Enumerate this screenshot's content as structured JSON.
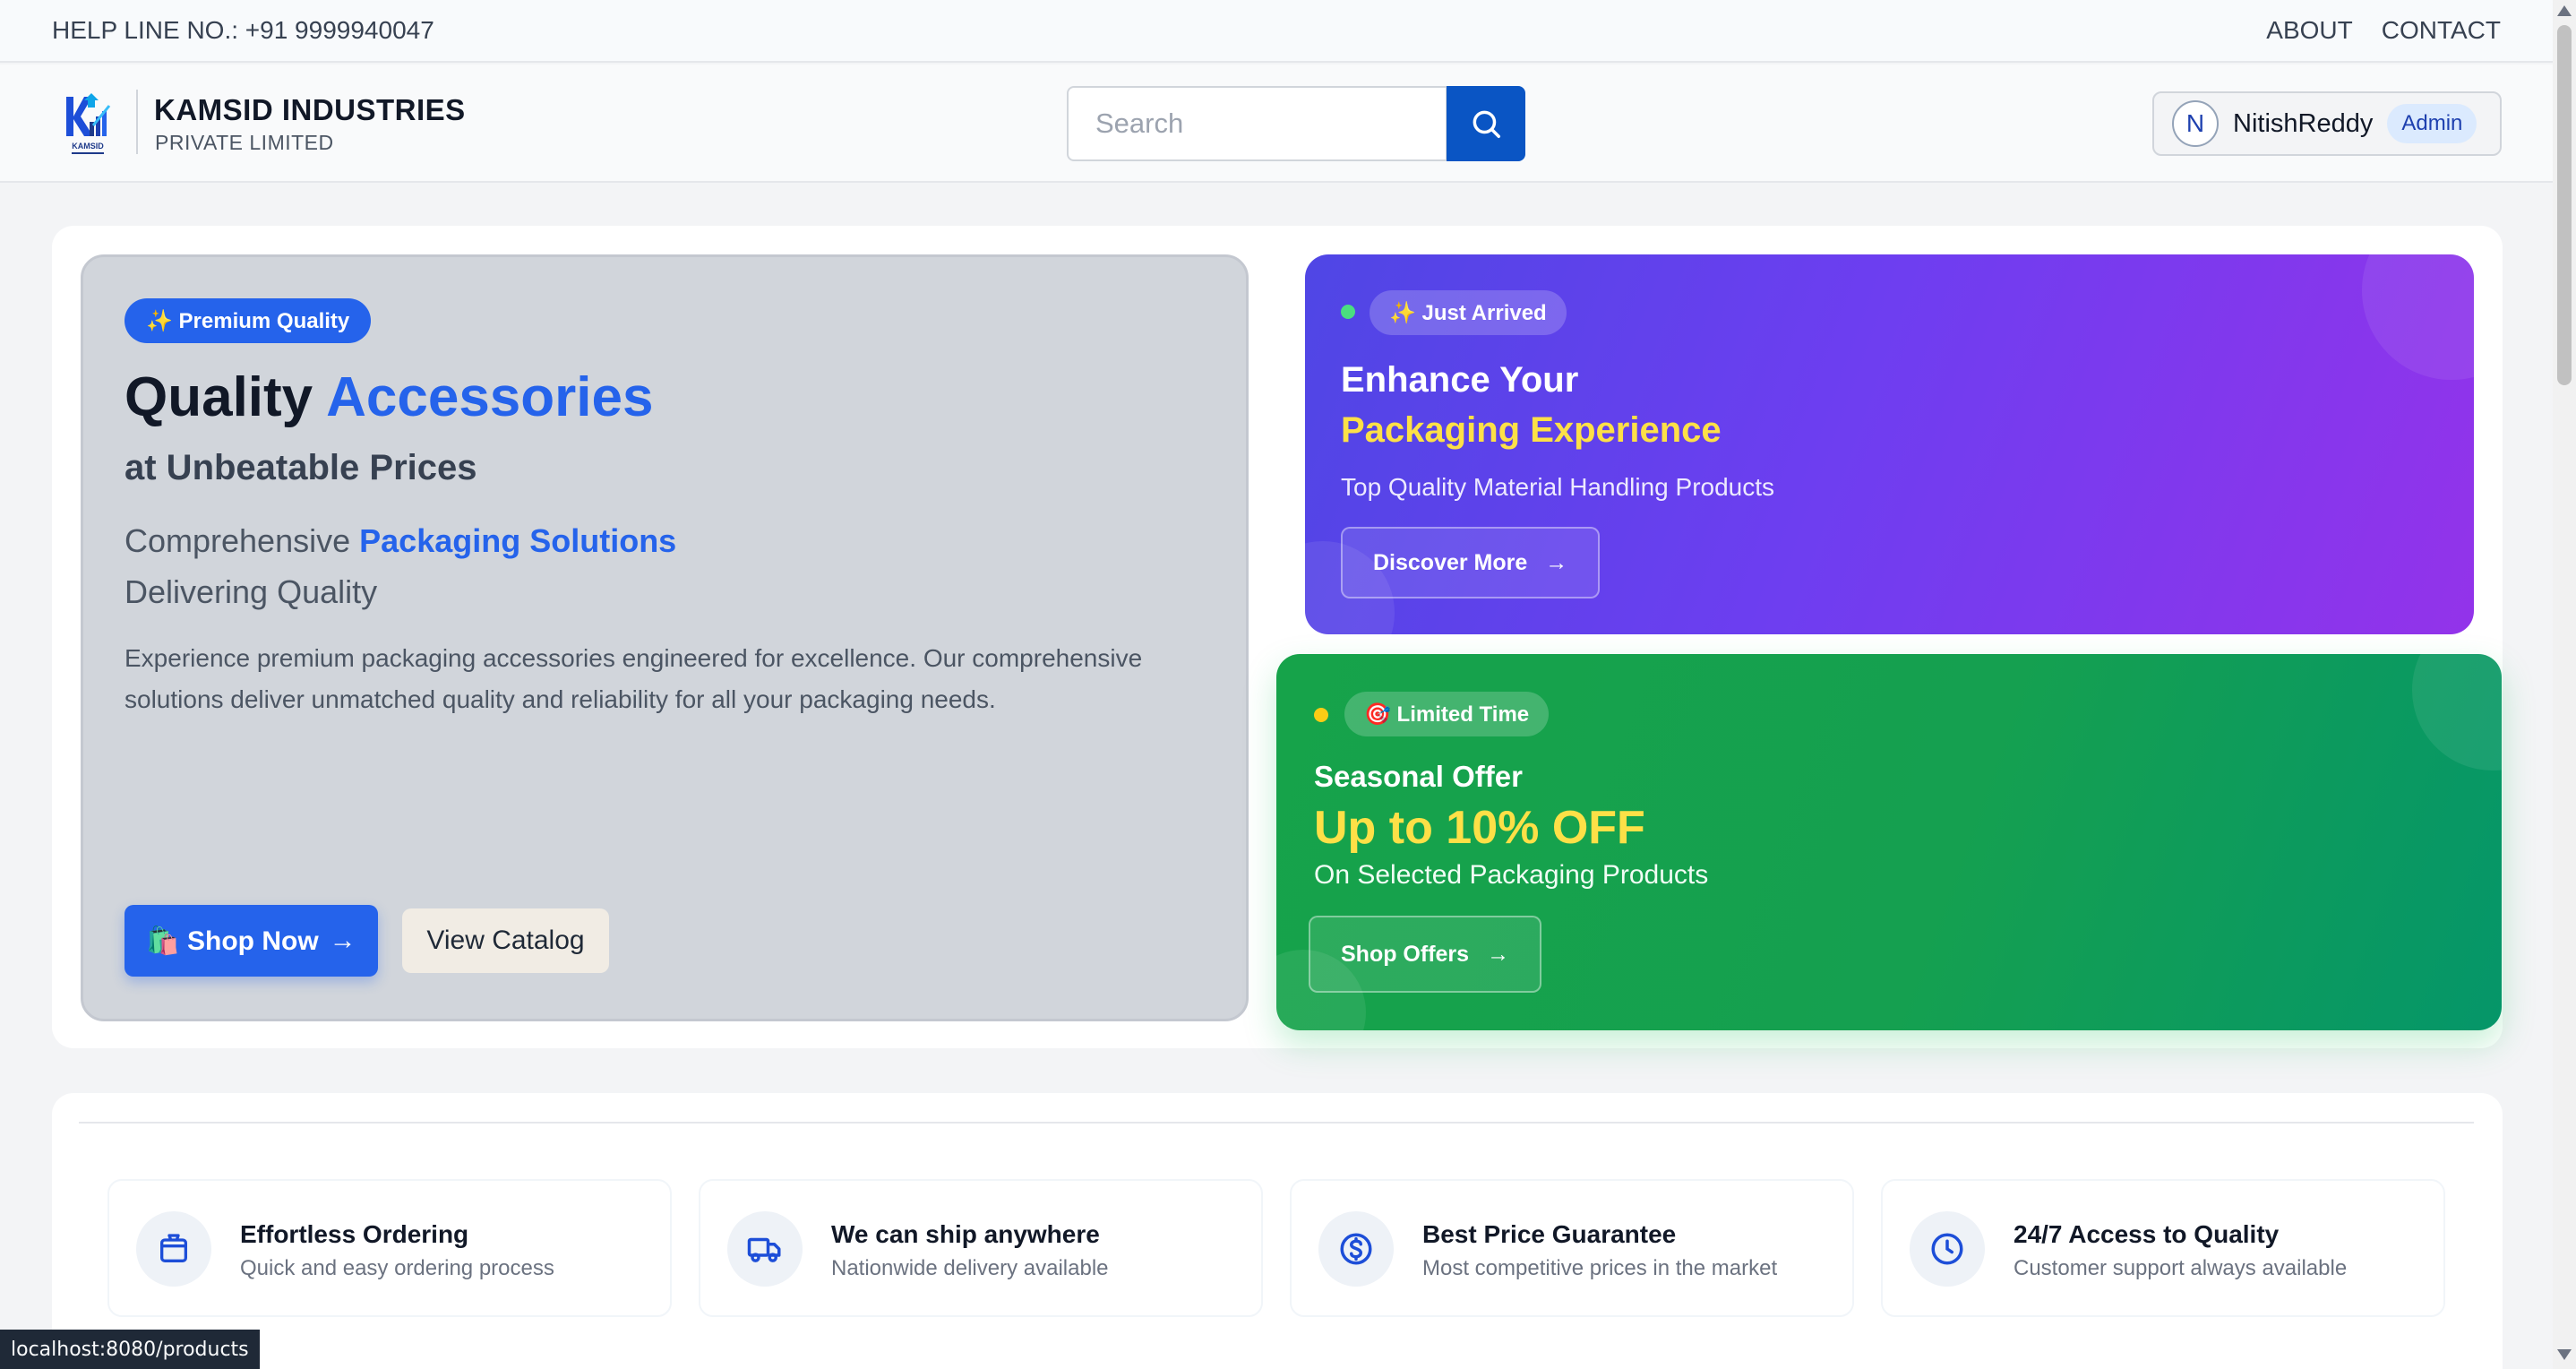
{
  "topbar": {
    "helpline": "HELP LINE NO.: +91 9999940047",
    "about": "ABOUT",
    "contact": "CONTACT"
  },
  "brand": {
    "name": "KAMSID INDUSTRIES",
    "sub": "PRIVATE LIMITED",
    "logo_text": "KAMSID"
  },
  "search": {
    "placeholder": "Search",
    "icon": "search-icon"
  },
  "user": {
    "initial": "N",
    "name": "NitishReddy",
    "role": "Admin"
  },
  "hero": {
    "badge": "✨ Premium Quality",
    "title_prefix": "Quality",
    "title_accent": "Accessories",
    "subtitle": "at Unbeatable Prices",
    "comp_prefix": "Comprehensive",
    "comp_accent": "Packaging Solutions",
    "delivering": "Delivering Quality",
    "description": "Experience premium packaging accessories engineered for excellence. Our comprehensive solutions deliver unmatched quality and reliability for all your packaging needs.",
    "shop_now": "🛍️ Shop Now",
    "shop_arrow": "→",
    "view_catalog": "View Catalog"
  },
  "promo_purple": {
    "badge": "✨ Just Arrived",
    "title_line1": "Enhance Your",
    "title_line2": "Packaging Experience",
    "subtitle": "Top Quality Material Handling Products",
    "button": "Discover More",
    "arrow": "→",
    "colors": {
      "from": "#4f46e5",
      "to": "#9333ea",
      "highlight": "#fde047"
    }
  },
  "promo_green": {
    "badge": "🎯 Limited Time",
    "title": "Seasonal Offer",
    "offer": "Up to 10% OFF",
    "subtitle": "On Selected Packaging Products",
    "button": "Shop Offers",
    "arrow": "→",
    "colors": {
      "from": "#16a34a",
      "to": "#059669",
      "highlight": "#fde047"
    }
  },
  "features": [
    {
      "icon": "package-icon",
      "title": "Effortless Ordering",
      "subtitle": "Quick and easy ordering process"
    },
    {
      "icon": "truck-icon",
      "title": "We can ship anywhere",
      "subtitle": "Nationwide delivery available"
    },
    {
      "icon": "dollar-icon",
      "title": "Best Price Guarantee",
      "subtitle": "Most competitive prices in the market"
    },
    {
      "icon": "clock-icon",
      "title": "24/7 Access to Quality",
      "subtitle": "Customer support always available"
    }
  ],
  "status_url": "localhost:8080/products"
}
